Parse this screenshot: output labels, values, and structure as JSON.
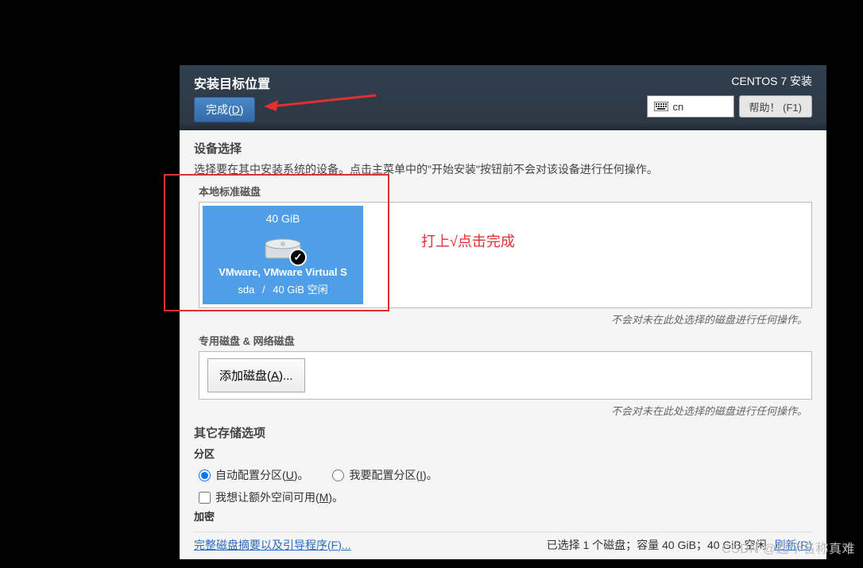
{
  "header": {
    "title": "安装目标位置",
    "done_label": "完成(",
    "done_key": "D",
    "done_close": ")",
    "brand": "CENTOS 7 安装",
    "keyboard": "cn",
    "help_label": "帮助！ (F1)"
  },
  "content": {
    "device_sel_heading": "设备选择",
    "device_sel_desc": "选择要在其中安装系统的设备。点击主菜单中的\"开始安装\"按钮前不会对该设备进行任何操作。",
    "local_disks_heading": "本地标准磁盘",
    "disk": {
      "size": "40 GiB",
      "name": "VMware, VMware Virtual S",
      "id": "sda",
      "sep": "/",
      "free": "40 GiB 空闲"
    },
    "note_no_action": "不会对未在此处选择的磁盘进行任何操作。",
    "special_disks_heading": "专用磁盘 & 网络磁盘",
    "add_disk_label": "添加磁盘(",
    "add_disk_key": "A",
    "add_disk_close": ")...",
    "other_storage_heading": "其它存储选项",
    "partition_heading": "分区",
    "radio_auto": "自动配置分区(",
    "radio_auto_key": "U",
    "radio_auto_close": ")。",
    "radio_manual": "我要配置分区(",
    "radio_manual_key": "I",
    "radio_manual_close": ")。",
    "check_extra_space": "我想让额外空间可用(",
    "check_extra_space_key": "M",
    "check_extra_space_close": ")。",
    "encryption_heading": "加密"
  },
  "footer": {
    "summary_link": "完整磁盘摘要以及引导程序(",
    "summary_key": "F",
    "summary_close": ")...",
    "selection_status": "已选择 1 个磁盘；容量 40 GiB；40 GiB 空闲",
    "refresh_label": "刷新(",
    "refresh_key": "R",
    "refresh_close": ")"
  },
  "annotation": {
    "text": "打上√点击完成"
  },
  "watermark": "CSDN @起个名称真难"
}
